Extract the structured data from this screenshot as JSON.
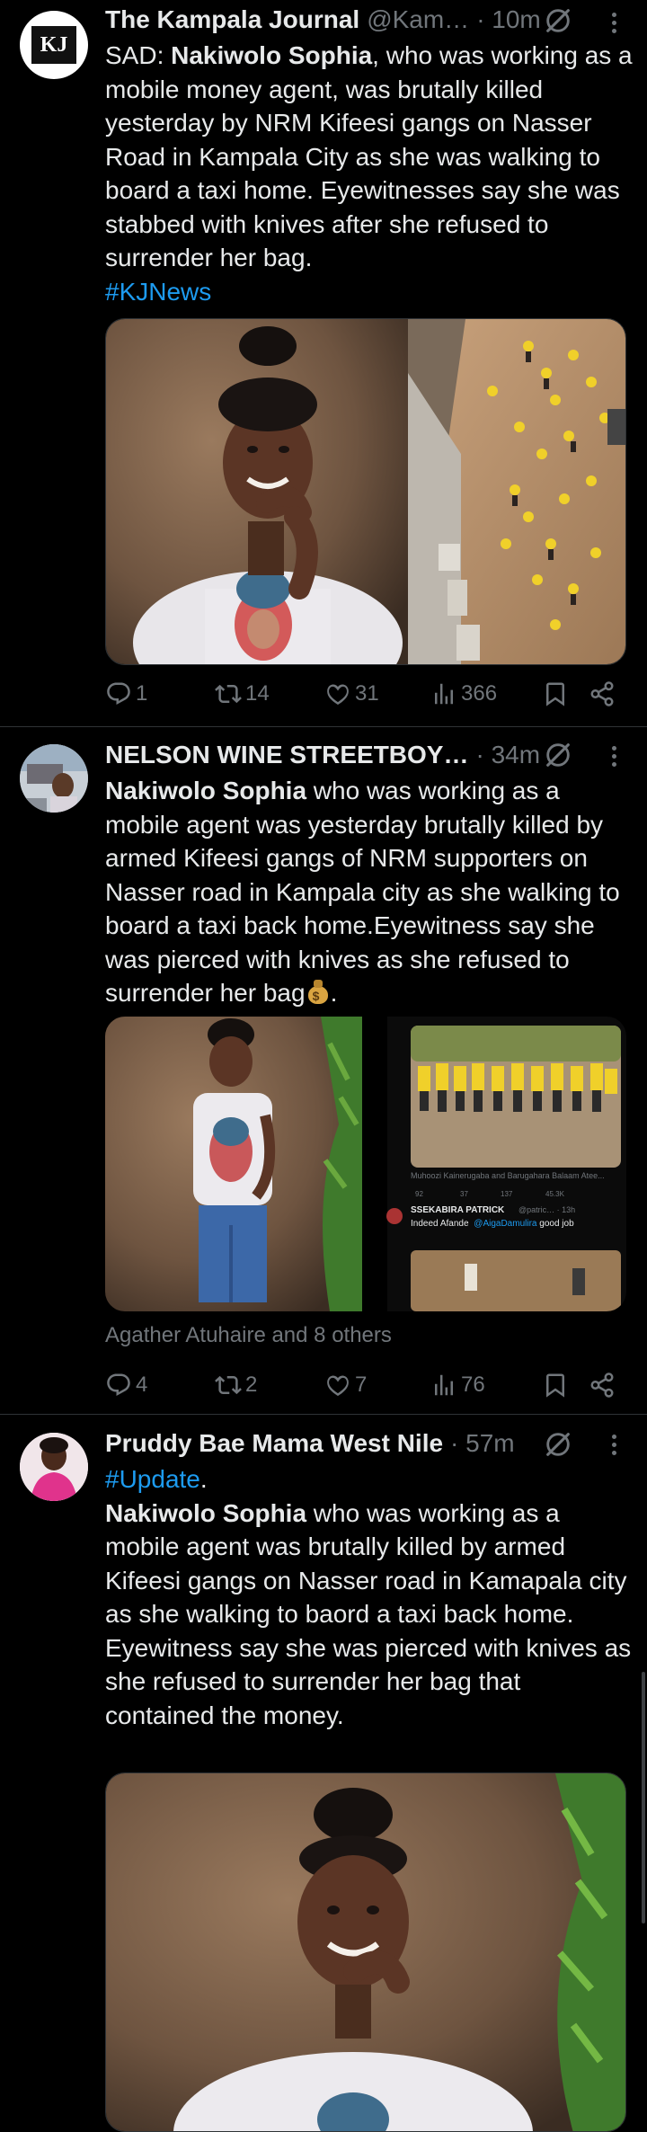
{
  "tweets": [
    {
      "author": "The Kampala Journal",
      "handle": "@Kam…",
      "time": "· 10m",
      "avatar_icon": "kampala-journal-logo",
      "avatar_text": "KJ",
      "text_prefix": "SAD: ",
      "text_bold": "Nakiwolo Sophia",
      "text_rest": ", who was working as a mobile money agent, was brutally killed yesterday by NRM Kifeesi gangs on Nasser Road in Kampala City as she was walking to board a taxi home. Eyewitnesses say she was stabbed with knives after she refused to surrender her bag.",
      "hashtag": "#KJNews",
      "stats": {
        "replies": "1",
        "reposts": "14",
        "likes": "31",
        "views": "366"
      }
    },
    {
      "author": "NELSON WINE STREETBOY…",
      "time": "· 34m",
      "avatar_icon": "user-photo-avatar",
      "text_bold": "Nakiwolo Sophia",
      "text_rest": " who was working as a mobile agent was yesterday brutally killed by armed Kifeesi gangs of NRM supporters on Nasser road in Kampala city as she walking to board a taxi back home.Eyewitness say she was pierced with knives as she refused to surrender her bag",
      "text_end": ".",
      "emoji_icon": "money-bag-emoji",
      "embedded": {
        "caption": "Muhoozi Kainerugaba and Barugahara Balaam Atee...",
        "mini_stats": [
          "92",
          "37",
          "137",
          "45.3K"
        ],
        "reply_name": "SSEKABIRA PATRICK",
        "reply_handle": "@patric… · 13h",
        "reply_text": "Indeed Afande",
        "reply_mention": "@AigaDamulira",
        "reply_end": " good job"
      },
      "liked_by": "Agather Atuhaire and 8 others",
      "stats": {
        "replies": "4",
        "reposts": "2",
        "likes": "7",
        "views": "76"
      }
    },
    {
      "author": "Pruddy Bae Mama West Nile",
      "time": "· 57m",
      "avatar_icon": "woman-pink-dress-avatar",
      "hashtag": "#Update",
      "hashtag_end": ".",
      "text_bold": "Nakiwolo Sophia",
      "text_rest": " who was working as a mobile agent was brutally killed by armed Kifeesi gangs on Nasser road in Kamapala city as she walking to baord a taxi back home.",
      "text_para2": "Eyewitness say she was pierced with knives as she refused to surrender her bag that contained the money."
    }
  ],
  "colors": {
    "background": "#000000",
    "text": "#e7e9ea",
    "secondary": "#71767b",
    "accent": "#1d9bf0",
    "divider": "#2f3336"
  }
}
